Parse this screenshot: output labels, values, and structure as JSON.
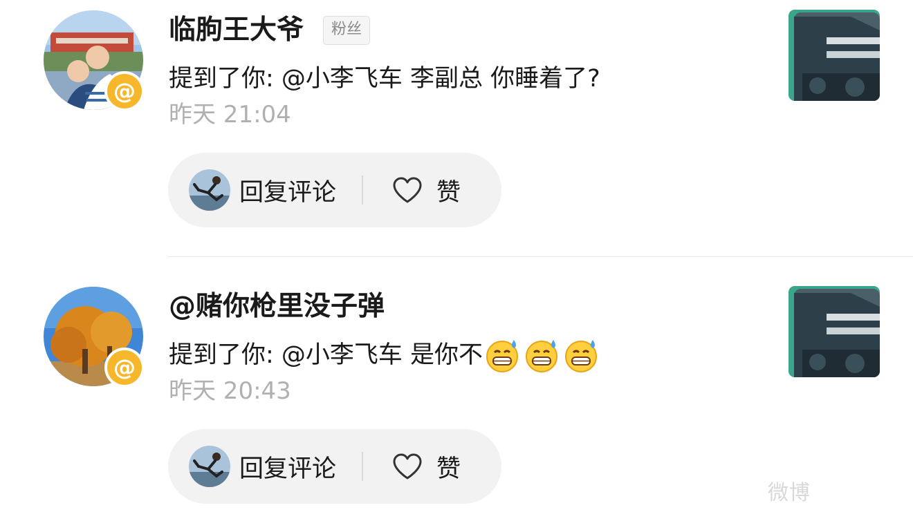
{
  "notifications": [
    {
      "user_name": "临朐王大爷",
      "badge": "粉丝",
      "mention_text": "提到了你: @小李飞车  李副总 你睡着了?",
      "emoji": [],
      "time": "昨天 21:04",
      "avatar_badge_icon": "at-sign-icon",
      "reply_label": "回复评论",
      "like_label": "赞"
    },
    {
      "user_name": "@赌你枪里没子弹",
      "badge": "",
      "mention_text": "提到了你: @小李飞车 是你不",
      "emoji": [
        "grinning-sweat-emoji",
        "grinning-sweat-emoji",
        "grinning-sweat-emoji"
      ],
      "time": "昨天 20:43",
      "avatar_badge_icon": "at-sign-icon",
      "reply_label": "回复评论",
      "like_label": "赞"
    }
  ],
  "watermark": "微博",
  "colors": {
    "mention_badge": "#f7b72a",
    "action_bg": "#f2f2f2",
    "time_text": "#b0b0b0",
    "thumb_accent": "#3aa58a"
  }
}
